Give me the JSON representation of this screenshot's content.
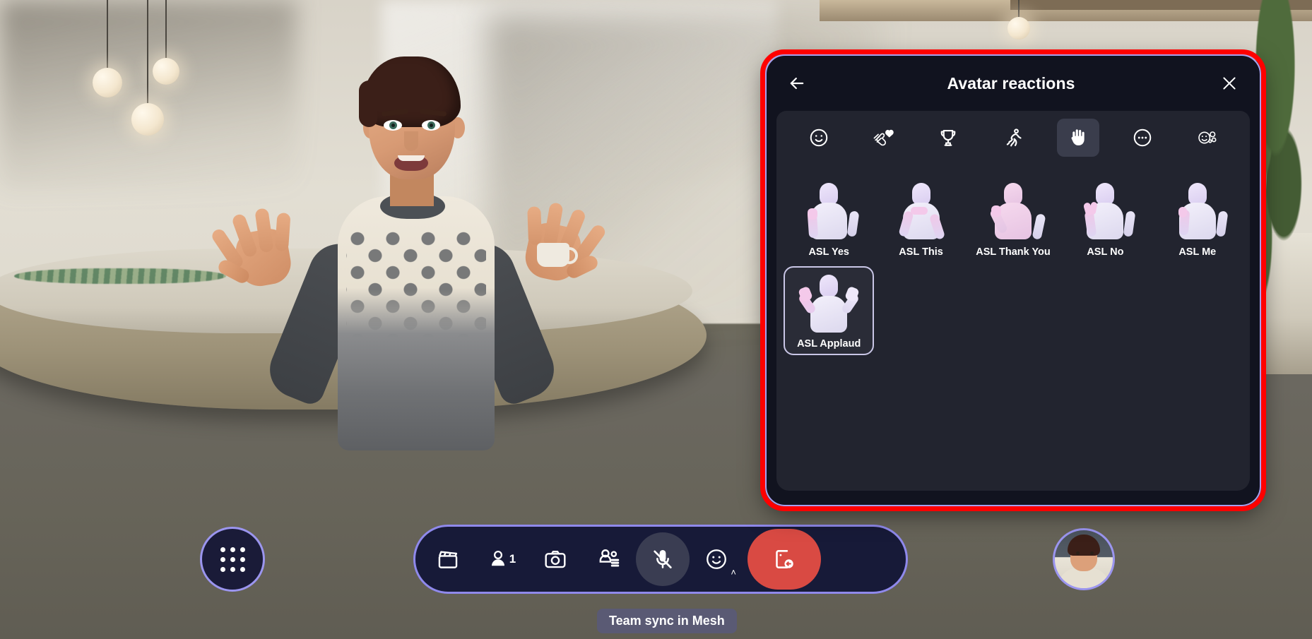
{
  "panel": {
    "title": "Avatar reactions",
    "back_label": "Back",
    "close_label": "Close",
    "tabs": [
      {
        "id": "emoji",
        "icon": "smiley-face-icon",
        "label": "Emoji",
        "active": false
      },
      {
        "id": "applause",
        "icon": "clapping-hands-heart-icon",
        "label": "Applause",
        "active": false
      },
      {
        "id": "celebrate",
        "icon": "trophy-icon",
        "label": "Celebrate",
        "active": false
      },
      {
        "id": "dance",
        "icon": "dancing-person-icon",
        "label": "Dance",
        "active": false
      },
      {
        "id": "asl",
        "icon": "raised-hand-icon",
        "label": "ASL",
        "active": true
      },
      {
        "id": "more",
        "icon": "more-ellipsis-icon",
        "label": "More",
        "active": false
      },
      {
        "id": "settings",
        "icon": "reaction-settings-icon",
        "label": "Settings",
        "active": false
      }
    ],
    "reactions": [
      {
        "label": "ASL Yes",
        "pose": "yes",
        "selected": false
      },
      {
        "label": "ASL This",
        "pose": "this",
        "selected": false
      },
      {
        "label": "ASL Thank You",
        "pose": "thankyou",
        "selected": false
      },
      {
        "label": "ASL No",
        "pose": "no",
        "selected": false
      },
      {
        "label": "ASL Me",
        "pose": "me",
        "selected": false
      },
      {
        "label": "ASL Applaud",
        "pose": "applaud",
        "selected": true
      }
    ]
  },
  "toolbar": {
    "apps_label": "Apps",
    "items": [
      {
        "id": "scene",
        "icon": "clapperboard-icon",
        "label": "Scene",
        "badge": ""
      },
      {
        "id": "participants",
        "icon": "person-icon",
        "label": "People",
        "badge": "1"
      },
      {
        "id": "camera",
        "icon": "camera-icon",
        "label": "Camera",
        "badge": ""
      },
      {
        "id": "chat",
        "icon": "people-chat-icon",
        "label": "Chat",
        "badge": ""
      },
      {
        "id": "mic",
        "icon": "microphone-muted-icon",
        "label": "Unmute",
        "badge": "",
        "state": "muted"
      },
      {
        "id": "reactions",
        "icon": "smiley-face-icon",
        "label": "Reactions",
        "badge": "",
        "caret": "˄"
      },
      {
        "id": "leave",
        "icon": "leave-door-icon",
        "label": "Leave",
        "badge": ""
      }
    ]
  },
  "tooltip": {
    "text": "Team sync in Mesh"
  },
  "self_view": {
    "label": "Your avatar"
  },
  "colors": {
    "panel_bg": "#11131f",
    "panel_surface": "#22242f",
    "panel_border": "#a8a0ee",
    "highlight": "#ff0000",
    "toolbar_bg": "#171a38",
    "toolbar_border": "#8f89ec",
    "leave_button": "#d94a43",
    "tab_active": "#3a3d4c",
    "text": "#ffffff",
    "tooltip_bg": "#5a5a74"
  }
}
